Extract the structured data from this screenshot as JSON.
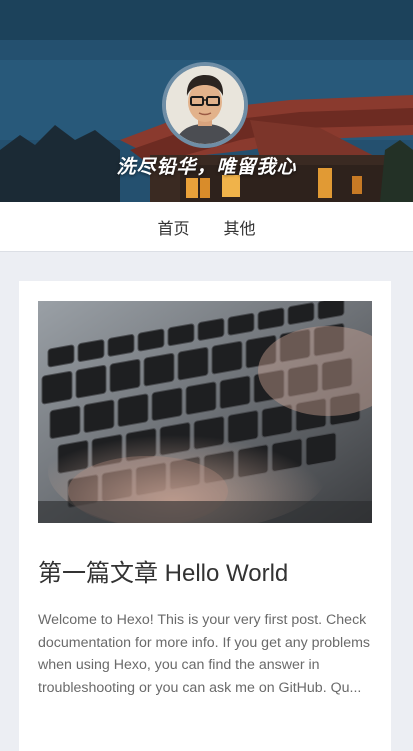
{
  "header": {
    "motto": "洗尽铅华，唯留我心"
  },
  "nav": {
    "items": [
      {
        "label": "首页"
      },
      {
        "label": "其他"
      }
    ]
  },
  "post": {
    "title": "第一篇文章 Hello World",
    "excerpt": "Welcome to Hexo! This is your very first post. Check documentation for more info. If you get any problems when using Hexo, you can find the answer in troubleshooting or you can ask me on GitHub. Qu..."
  },
  "colors": {
    "banner_sky": "#245675",
    "nav_bg": "#ffffff",
    "page_bg": "#eceef3",
    "title_text": "#333333",
    "excerpt_text": "#6a6a6a"
  }
}
